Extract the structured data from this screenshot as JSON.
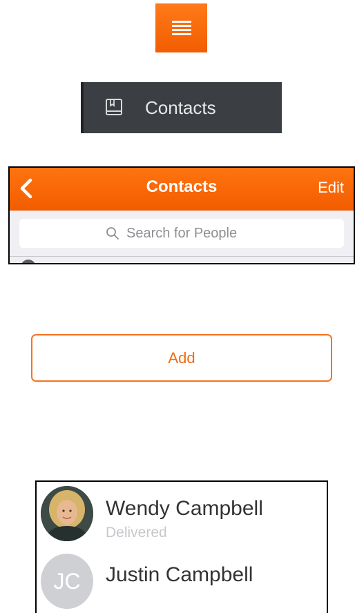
{
  "menu_button": {
    "icon": "hamburger-menu-icon",
    "color": "#f25d00"
  },
  "side_menu": {
    "item_label": "Contacts",
    "item_icon": "address-book-icon",
    "background": "#3b3f43"
  },
  "contacts_nav": {
    "back_icon": "chevron-left-icon",
    "title": "Contacts",
    "edit_label": "Edit",
    "bar_color": "#f25c00"
  },
  "search": {
    "icon": "search-icon",
    "placeholder": "Search for People"
  },
  "add_button": {
    "label": "Add",
    "accent": "#f26b12"
  },
  "contacts": [
    {
      "name": "Wendy Campbell",
      "status": "Delivered",
      "avatar": "photo"
    },
    {
      "name": "Justin Campbell",
      "initials": "JC",
      "avatar": "initials"
    }
  ]
}
